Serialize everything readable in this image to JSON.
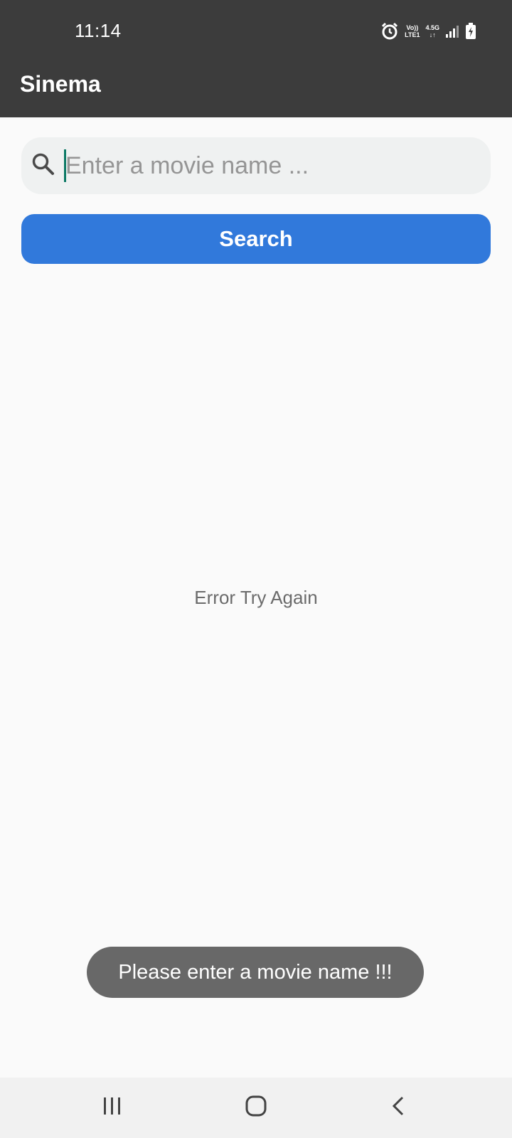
{
  "status_bar": {
    "time": "11:14",
    "network_line1": "Vo))",
    "network_line2": "LTE1",
    "data_type": "4.5G",
    "battery_level": "7",
    "icons": [
      "alarm-icon",
      "signal-icon",
      "battery-icon"
    ]
  },
  "app_bar": {
    "title": "Sinema"
  },
  "search": {
    "placeholder": "Enter a movie name ...",
    "value": "",
    "button_label": "Search"
  },
  "content": {
    "message": "Error Try Again"
  },
  "toast": {
    "message": "Please enter a movie name !!!"
  },
  "nav_bar": {
    "icons": [
      "recents-icon",
      "home-icon",
      "back-icon"
    ]
  },
  "colors": {
    "app_bar": "#3c3c3c",
    "accent": "#3179db",
    "background": "#fafafa",
    "toast": "#686868",
    "caret": "#0d7a66"
  }
}
